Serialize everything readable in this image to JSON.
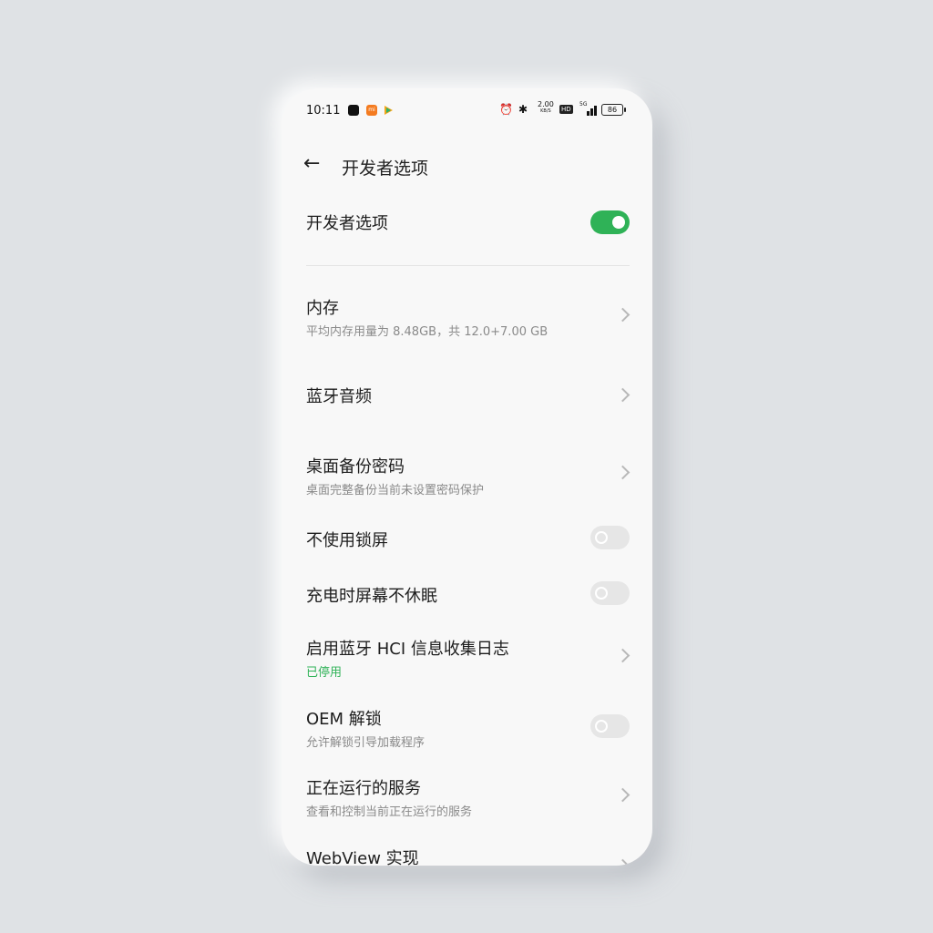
{
  "status_bar": {
    "time": "10:11",
    "notification_icons": [
      "app-black-icon",
      "mi-icon",
      "play-icon"
    ],
    "mi_label": "mi",
    "speed_value": "2.00",
    "speed_unit": "KB/S",
    "hd_label": "HD",
    "network_label": "5G",
    "battery": "86",
    "icons": [
      "alarm-icon",
      "bluetooth-icon",
      "signal-icon",
      "battery-icon"
    ]
  },
  "header": {
    "back_icon": "arrow-left-icon",
    "title": "开发者选项"
  },
  "colors": {
    "accent": "#2fb257",
    "background": "#f8f8f8"
  },
  "settings": [
    {
      "label": "开发者选项",
      "type": "toggle",
      "on": true
    },
    {
      "label": "内存",
      "sub": "平均内存用量为 8.48GB，共 12.0+7.00 GB",
      "type": "chevron"
    },
    {
      "label": "蓝牙音频",
      "type": "chevron"
    },
    {
      "label": "桌面备份密码",
      "sub": "桌面完整备份当前未设置密码保护",
      "type": "chevron"
    },
    {
      "label": "不使用锁屏",
      "type": "toggle",
      "on": false
    },
    {
      "label": "充电时屏幕不休眠",
      "type": "toggle",
      "on": false
    },
    {
      "label": "启用蓝牙 HCI 信息收集日志",
      "sub": "已停用",
      "sub_color": "green",
      "type": "chevron"
    },
    {
      "label": "OEM 解锁",
      "sub": "允许解锁引导加载程序",
      "type": "toggle",
      "on": false
    },
    {
      "label": "正在运行的服务",
      "sub": "查看和控制当前正在运行的服务",
      "type": "chevron"
    },
    {
      "label": "WebView 实现",
      "type": "chevron"
    }
  ]
}
